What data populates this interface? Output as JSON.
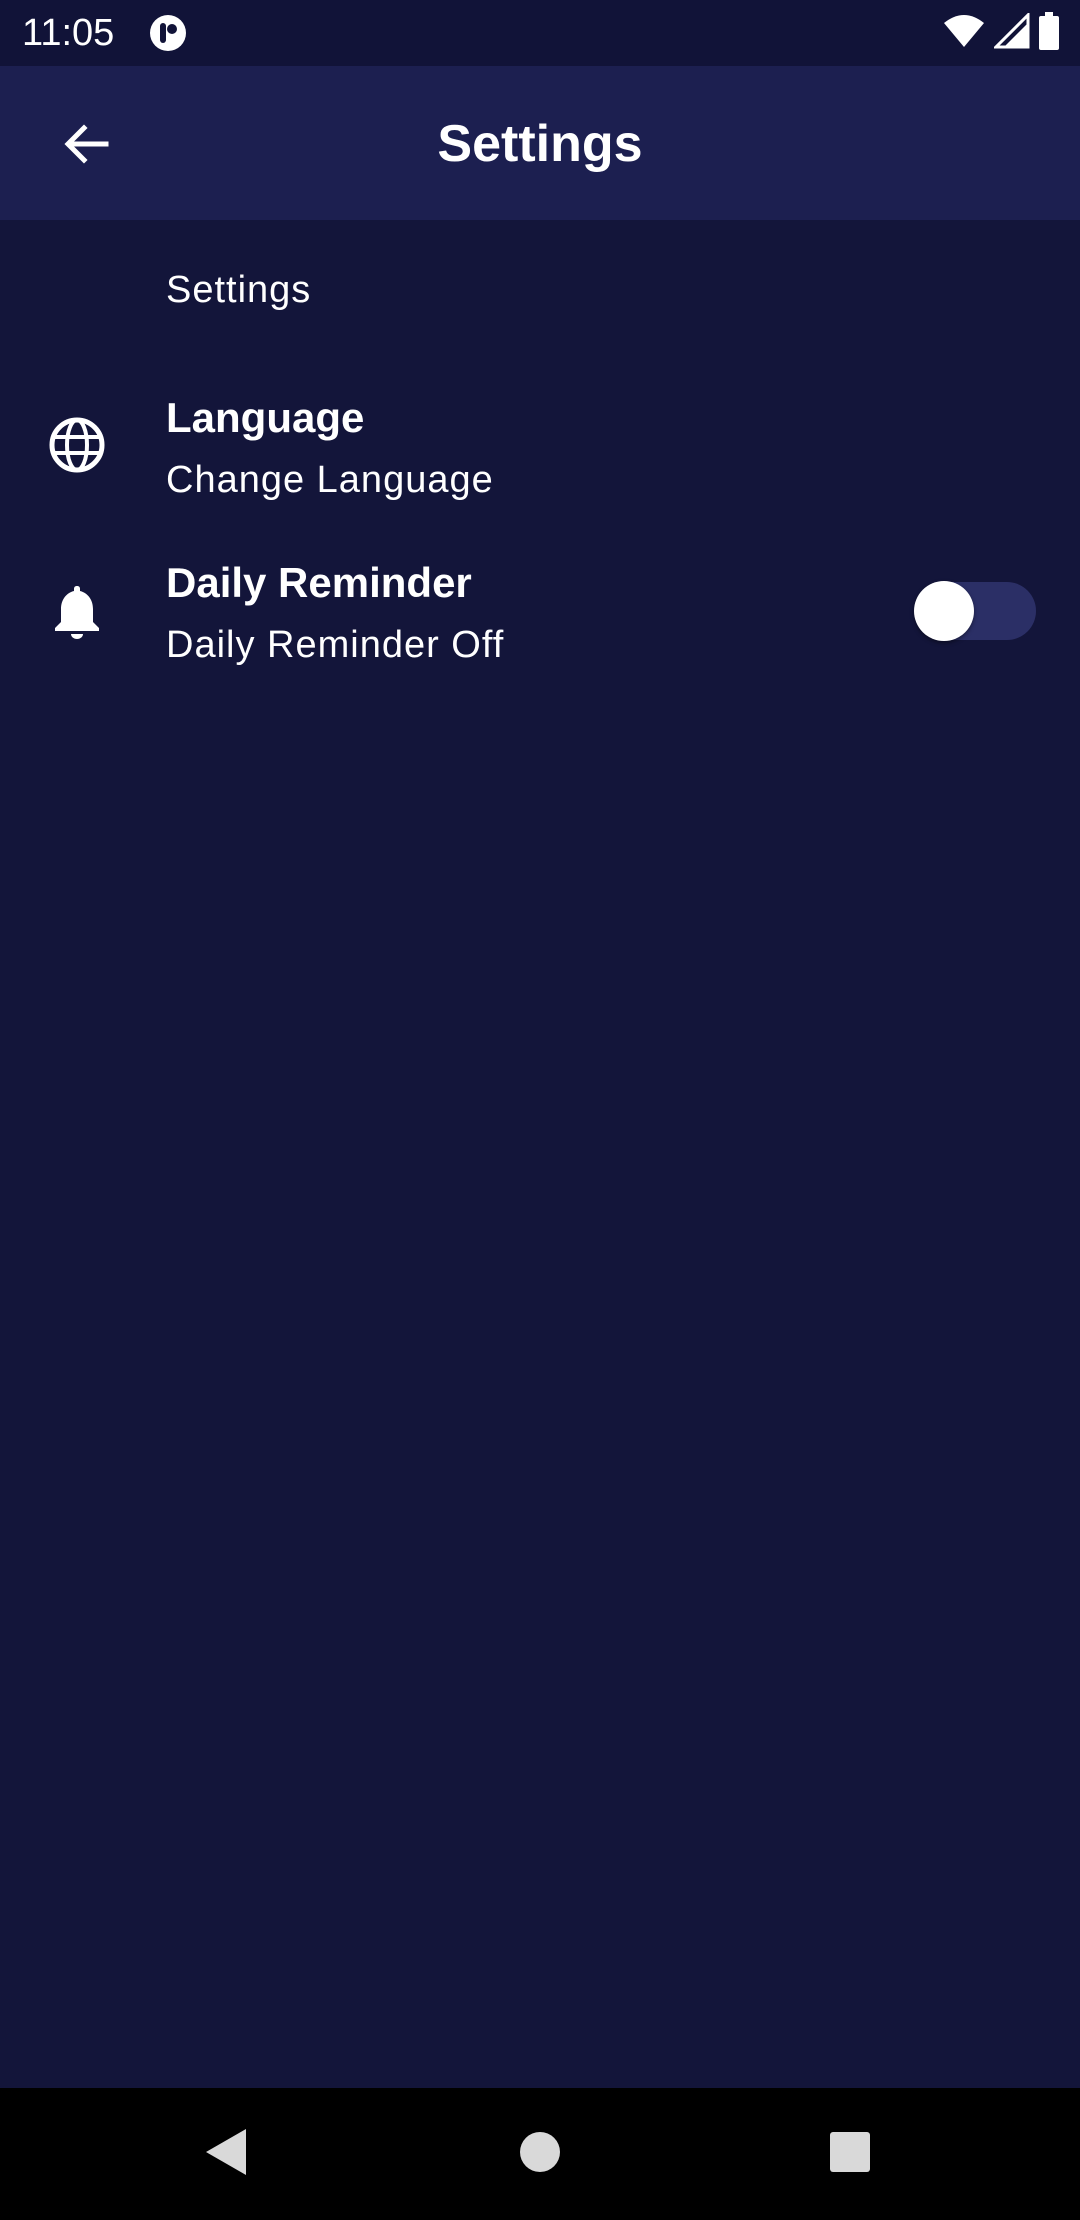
{
  "status_bar": {
    "time": "11:05",
    "icons": [
      "app-notification-icon",
      "wifi-icon",
      "cell-signal-icon",
      "battery-icon"
    ]
  },
  "app_bar": {
    "title": "Settings",
    "back_icon": "arrow-back-icon"
  },
  "content": {
    "section_header": "Settings",
    "items": [
      {
        "icon": "globe-icon",
        "title": "Language",
        "subtitle": "Change Language"
      },
      {
        "icon": "bell-icon",
        "title": "Daily Reminder",
        "subtitle": "Daily Reminder Off",
        "toggle": {
          "checked": false
        }
      }
    ]
  },
  "nav_bar": {
    "buttons": [
      "back-triangle-icon",
      "home-circle-icon",
      "recents-square-icon"
    ]
  },
  "colors": {
    "background": "#13153a",
    "app_bar": "#1c1f50",
    "status_bar": "#111338",
    "toggle_track": "#2b2f66",
    "text": "#ffffff"
  }
}
